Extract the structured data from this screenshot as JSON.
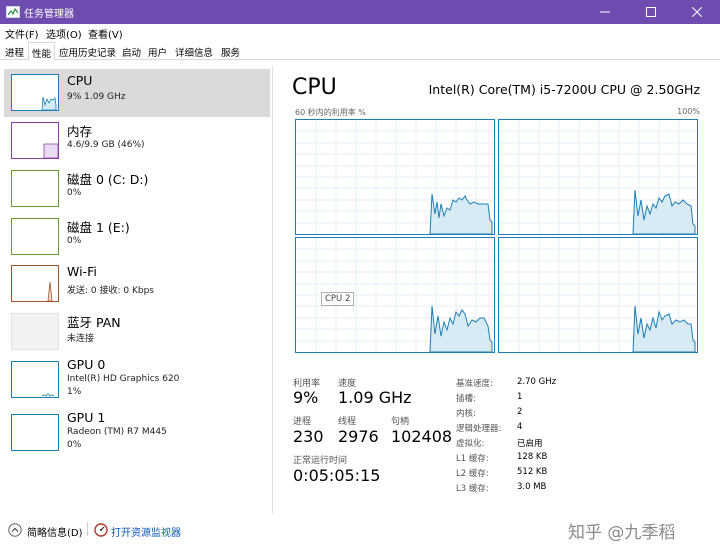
{
  "window": {
    "title": "任务管理器"
  },
  "menu": [
    "文件(F)",
    "选项(O)",
    "查看(V)"
  ],
  "tabs": [
    "进程",
    "性能",
    "应用历史记录",
    "启动",
    "用户",
    "详细信息",
    "服务"
  ],
  "active_tab": "性能",
  "sidebar": {
    "items": [
      {
        "title": "CPU",
        "sub": "9% 1.09 GHz",
        "sub2": ""
      },
      {
        "title": "内存",
        "sub": "4.6/9.9 GB (46%)",
        "sub2": ""
      },
      {
        "title": "磁盘 0 (C: D:)",
        "sub": "0%",
        "sub2": ""
      },
      {
        "title": "磁盘 1 (E:)",
        "sub": "0%",
        "sub2": ""
      },
      {
        "title": "Wi-Fi",
        "sub": "发送: 0 接收: 0 Kbps",
        "sub2": ""
      },
      {
        "title": "蓝牙 PAN",
        "sub": "未连接",
        "sub2": ""
      },
      {
        "title": "GPU 0",
        "sub": "Intel(R) HD Graphics 620",
        "sub2": "1%"
      },
      {
        "title": "GPU 1",
        "sub": "Radeon (TM) R7 M445",
        "sub2": "0%"
      }
    ]
  },
  "main": {
    "title": "CPU",
    "model": "Intel(R) Core(TM) i5-7200U CPU @ 2.50GHz",
    "graph_label": "60 秒内的利用率 %",
    "graph_max": "100%",
    "cpu_tag": "CPU 2",
    "stats": {
      "util_label": "利用率",
      "util_value": "9%",
      "speed_label": "速度",
      "speed_value": "1.09 GHz",
      "proc_label": "进程",
      "proc_value": "230",
      "thread_label": "线程",
      "thread_value": "2976",
      "handle_label": "句柄",
      "handle_value": "102408",
      "uptime_label": "正常运行时间",
      "uptime_value": "0:05:05:15"
    },
    "details": [
      {
        "label": "基准速度:",
        "value": "2.70 GHz"
      },
      {
        "label": "插槽:",
        "value": "1"
      },
      {
        "label": "内核:",
        "value": "2"
      },
      {
        "label": "逻辑处理器:",
        "value": "4"
      },
      {
        "label": "虚拟化:",
        "value": "已启用"
      },
      {
        "label": "L1 缓存:",
        "value": "128 KB"
      },
      {
        "label": "L2 缓存:",
        "value": "512 KB"
      },
      {
        "label": "L3 缓存:",
        "value": "3.0 MB"
      }
    ]
  },
  "footer": {
    "fewer": "简略信息(D)",
    "resmon": "打开资源监视器"
  },
  "watermark": "知乎 @九季稻",
  "colors": {
    "accent": "#6f4cb0",
    "cpu": "#1b7fb3",
    "memory": "#8b3fa8",
    "disk": "#6a9b2a",
    "wifi": "#a0522d",
    "gpu": "#1b7fb3"
  }
}
